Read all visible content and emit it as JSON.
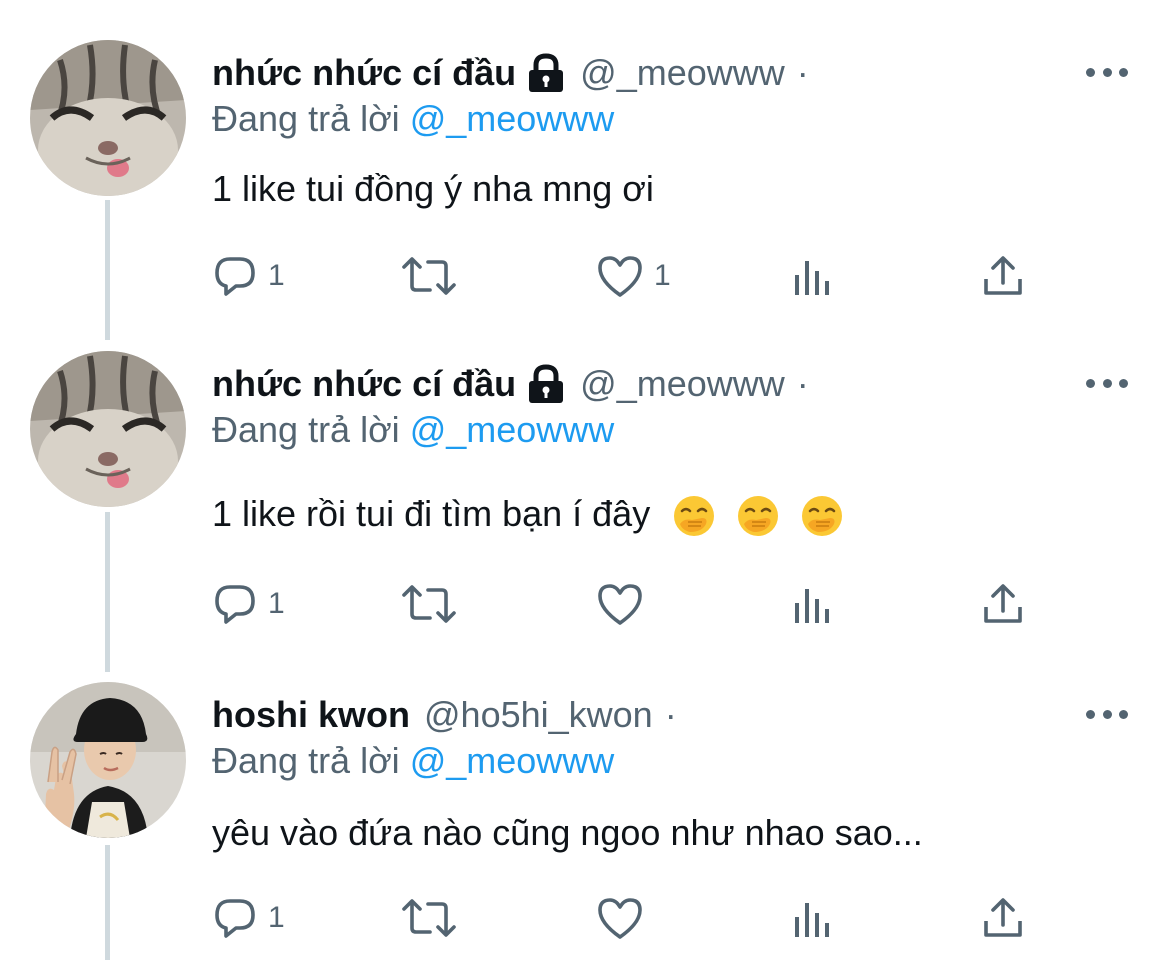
{
  "colors": {
    "text": "#0f1419",
    "muted": "#536471",
    "accent": "#1d9bf0",
    "thread_line": "#cfd9de"
  },
  "tweets": [
    {
      "display_name": "nhức nhức cí đầu",
      "locked": true,
      "handle": "@_meowww",
      "separator": "·",
      "replying_prefix": "Đang trả lời",
      "replying_to": "@_meowww",
      "text": "1 like tui đồng ý nha mng ơi",
      "emojis": [],
      "replies": "1",
      "retweets": "",
      "likes": "1",
      "avatar_icon": "cat-avatar"
    },
    {
      "display_name": "nhức nhức cí đầu",
      "locked": true,
      "handle": "@_meowww",
      "separator": "·",
      "replying_prefix": "Đang trả lời",
      "replying_to": "@_meowww",
      "text": "1 like rồi tui đi tìm bạn í đây",
      "emojis": [
        "hand-over-mouth-emoji",
        "hand-over-mouth-emoji",
        "hand-over-mouth-emoji"
      ],
      "replies": "1",
      "retweets": "",
      "likes": "",
      "avatar_icon": "cat-avatar"
    },
    {
      "display_name": "hoshi kwon",
      "locked": false,
      "handle": "@ho5hi_kwon",
      "separator": "·",
      "replying_prefix": "Đang trả lời",
      "replying_to": "@_meowww",
      "text": "yêu vào đứa nào cũng ngoo như nhao sao...",
      "emojis": [],
      "replies": "1",
      "retweets": "",
      "likes": "",
      "avatar_icon": "person-avatar"
    }
  ]
}
